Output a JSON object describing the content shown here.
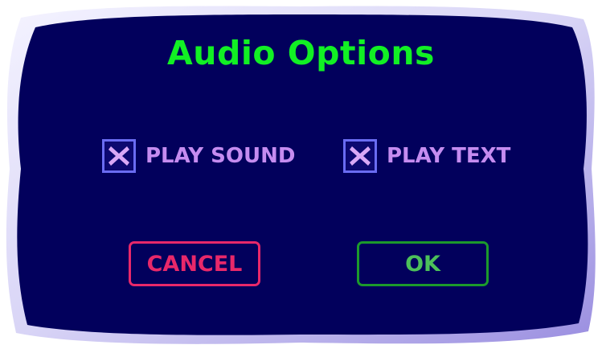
{
  "dialog": {
    "title": "Audio Options",
    "options": [
      {
        "label": "PLAY SOUND",
        "checked": true
      },
      {
        "label": "PLAY TEXT",
        "checked": true
      }
    ],
    "buttons": {
      "cancel_label": "CANCEL",
      "ok_label": "OK"
    }
  },
  "colors": {
    "panel": "#02005c",
    "title": "#12f024",
    "option_text": "#c58cf0",
    "checkbox_border": "#6a6cf2",
    "checkbox_mark": "#d9a8f6",
    "cancel": "#e8286a",
    "ok_border": "#1c9a2c",
    "ok_text": "#4cc05a"
  },
  "icons": {
    "check_mark": "x-mark-icon"
  }
}
